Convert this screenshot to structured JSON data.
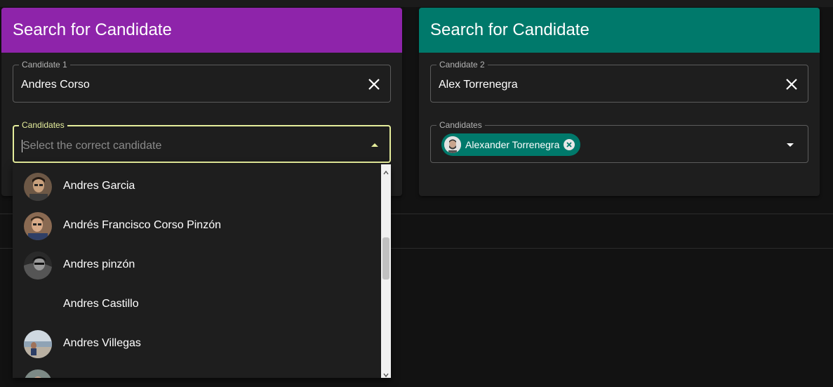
{
  "left_card": {
    "header_color": "#8e24aa",
    "title": "Search for Candidate",
    "candidate_field": {
      "label": "Candidate 1",
      "value": "Andres Corso"
    },
    "candidates_field": {
      "label": "Candidates",
      "placeholder": "Select the correct candidate",
      "focus_color": "#e6ee9c"
    },
    "options": [
      {
        "label": "Andres Garcia",
        "avatar": "photo"
      },
      {
        "label": "Andrés Francisco Corso Pinzón",
        "avatar": "photo"
      },
      {
        "label": "Andres pinzón",
        "avatar": "photo-grayscale"
      },
      {
        "label": "Andres Castillo",
        "avatar": "none"
      },
      {
        "label": "Andres Villegas",
        "avatar": "photo"
      },
      {
        "label": "",
        "avatar": "photo"
      }
    ]
  },
  "right_card": {
    "header_color": "#00796b",
    "title": "Search for Candidate",
    "candidate_field": {
      "label": "Candidate 2",
      "value": "Alex Torrenegra"
    },
    "candidates_field": {
      "label": "Candidates",
      "chip": {
        "label": "Alexander Torrenegra",
        "icon": "cancel-icon"
      }
    }
  },
  "icons": {
    "clear": "close-icon",
    "dropdown_open": "arrow-up-icon",
    "dropdown_closed": "arrow-down-icon"
  }
}
